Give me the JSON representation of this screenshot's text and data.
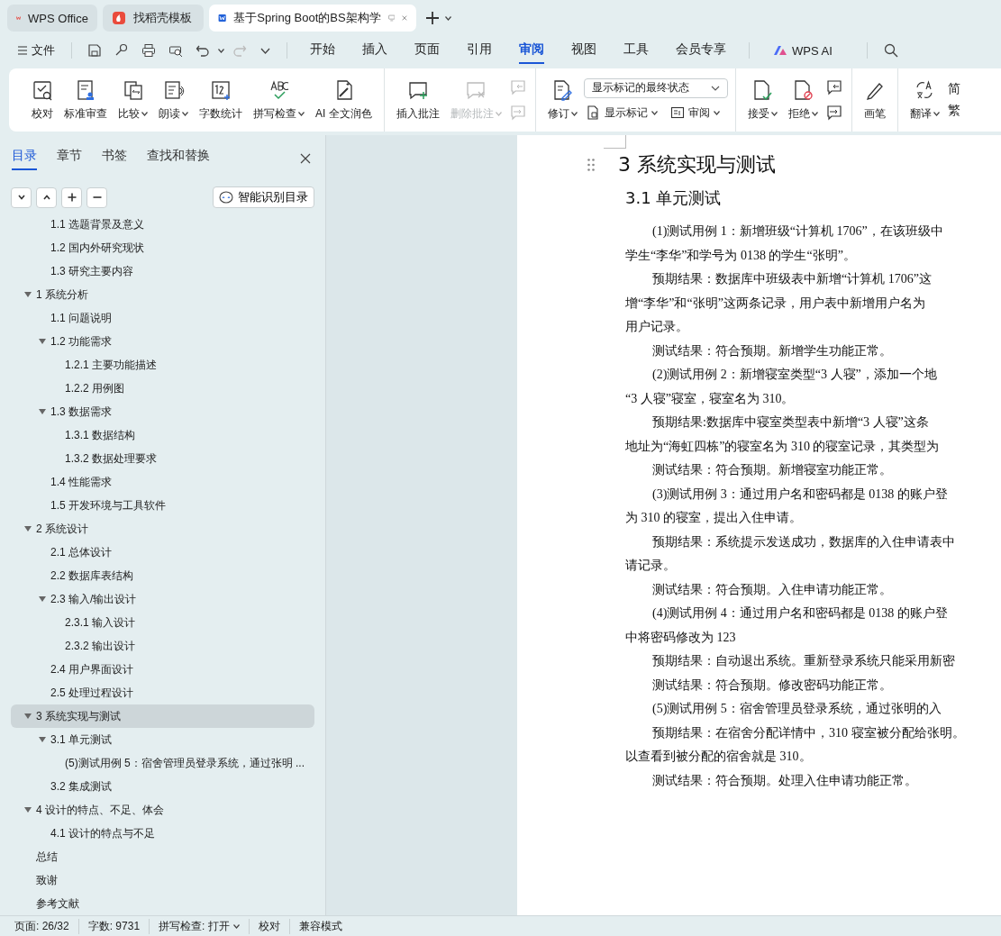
{
  "browser_tabs": [
    {
      "label": "WPS Office",
      "selected": false
    },
    {
      "label": "找稻壳模板",
      "selected": false
    },
    {
      "label": "基于Spring Boot的BS架构学",
      "selected": true
    }
  ],
  "menu": {
    "file_label": "文件",
    "tabs": [
      {
        "label": "开始",
        "selected": false
      },
      {
        "label": "插入",
        "selected": false
      },
      {
        "label": "页面",
        "selected": false
      },
      {
        "label": "引用",
        "selected": false
      },
      {
        "label": "审阅",
        "selected": true
      },
      {
        "label": "视图",
        "selected": false
      },
      {
        "label": "工具",
        "selected": false
      },
      {
        "label": "会员专享",
        "selected": false
      }
    ],
    "ai_label": "WPS AI"
  },
  "ribbon": {
    "groups": [
      {
        "items": [
          {
            "kind": "big",
            "label": "校对",
            "dropdown": false,
            "disabled": false
          },
          {
            "kind": "big",
            "label": "标准审查",
            "dropdown": false,
            "disabled": false
          },
          {
            "kind": "big",
            "label": "比较",
            "dropdown": true,
            "disabled": false
          },
          {
            "kind": "big",
            "label": "朗读",
            "dropdown": true,
            "disabled": false
          },
          {
            "kind": "big",
            "label": "字数统计",
            "dropdown": false,
            "disabled": false
          },
          {
            "kind": "big",
            "label": "拼写检查",
            "dropdown": true,
            "disabled": false
          },
          {
            "kind": "big",
            "label": "AI 全文润色",
            "dropdown": false,
            "disabled": false
          }
        ]
      },
      {
        "items": [
          {
            "kind": "big",
            "label": "插入批注",
            "dropdown": false,
            "disabled": false
          },
          {
            "kind": "big",
            "label": "删除批注",
            "dropdown": true,
            "disabled": true
          },
          {
            "kind": "stack",
            "rows": [
              [
                {
                  "kind": "icon",
                  "disabled": true
                }
              ],
              [
                {
                  "kind": "icon",
                  "disabled": true
                }
              ]
            ]
          }
        ]
      },
      {
        "items": [
          {
            "kind": "big",
            "label": "修订",
            "dropdown": true,
            "disabled": false
          },
          {
            "kind": "stack",
            "rows": [
              [
                {
                  "kind": "select",
                  "label": "显示标记的最终状态",
                  "disabled": false
                }
              ],
              [
                {
                  "kind": "small",
                  "label": "显示标记",
                  "dropdown": true,
                  "disabled": false
                },
                {
                  "kind": "small",
                  "label": "审阅",
                  "dropdown": true,
                  "disabled": false
                }
              ]
            ]
          }
        ]
      },
      {
        "items": [
          {
            "kind": "big",
            "label": "接受",
            "dropdown": true,
            "disabled": false
          },
          {
            "kind": "big",
            "label": "拒绝",
            "dropdown": true,
            "disabled": false
          },
          {
            "kind": "stack",
            "rows": [
              [
                {
                  "kind": "icon",
                  "disabled": false
                }
              ],
              [
                {
                  "kind": "icon",
                  "disabled": false
                }
              ]
            ]
          }
        ]
      },
      {
        "items": [
          {
            "kind": "big",
            "label": "画笔",
            "dropdown": false,
            "disabled": false
          }
        ]
      },
      {
        "items": [
          {
            "kind": "big",
            "label": "翻译",
            "dropdown": true,
            "disabled": false
          },
          {
            "kind": "stack",
            "rows": [
              [
                {
                  "kind": "glyph",
                  "label": "简",
                  "disabled": false
                }
              ],
              [
                {
                  "kind": "glyph",
                  "label": "繁",
                  "disabled": false
                }
              ]
            ]
          }
        ]
      }
    ]
  },
  "toc": {
    "tabs": [
      {
        "label": "目录",
        "selected": true
      },
      {
        "label": "章节",
        "selected": false
      },
      {
        "label": "书签",
        "selected": false
      },
      {
        "label": "查找和替换",
        "selected": false
      }
    ],
    "smart_button": "智能识别目录",
    "continued_items": [
      {
        "label": "1.1 选题背景及意义",
        "selected": false
      },
      {
        "label": "1.2 国内外研究现状",
        "selected": false
      },
      {
        "label": "1.3 研究主要内容",
        "selected": false
      }
    ],
    "items": [
      {
        "label": "1 系统分析",
        "selected": false,
        "expanded": true,
        "children": [
          {
            "label": "1.1 问题说明",
            "selected": false
          },
          {
            "label": "1.2 功能需求",
            "selected": false,
            "expanded": true,
            "children": [
              {
                "label": "1.2.1 主要功能描述",
                "selected": false
              },
              {
                "label": "1.2.2 用例图",
                "selected": false
              }
            ]
          },
          {
            "label": "1.3 数据需求",
            "selected": false,
            "expanded": true,
            "children": [
              {
                "label": "1.3.1 数据结构",
                "selected": false
              },
              {
                "label": "1.3.2 数据处理要求",
                "selected": false
              }
            ]
          },
          {
            "label": "1.4 性能需求",
            "selected": false
          },
          {
            "label": "1.5 开发环境与工具软件",
            "selected": false
          }
        ]
      },
      {
        "label": "2 系统设计",
        "selected": false,
        "expanded": true,
        "children": [
          {
            "label": "2.1 总体设计",
            "selected": false
          },
          {
            "label": "2.2 数据库表结构",
            "selected": false
          },
          {
            "label": "2.3 输入/输出设计",
            "selected": false,
            "expanded": true,
            "children": [
              {
                "label": "2.3.1 输入设计",
                "selected": false
              },
              {
                "label": "2.3.2 输出设计",
                "selected": false
              }
            ]
          },
          {
            "label": "2.4 用户界面设计",
            "selected": false
          },
          {
            "label": "2.5 处理过程设计",
            "selected": false
          }
        ]
      },
      {
        "label": "3 系统实现与测试",
        "selected": true,
        "expanded": true,
        "children": [
          {
            "label": "3.1 单元测试",
            "selected": false,
            "expanded": true,
            "children": [
              {
                "label": "(5)测试用例 5：宿舍管理员登录系统，通过张明 ...",
                "selected": false
              }
            ]
          },
          {
            "label": "3.2 集成测试",
            "selected": false
          }
        ]
      },
      {
        "label": "4 设计的特点、不足、体会",
        "selected": false,
        "expanded": true,
        "children": [
          {
            "label": "4.1 设计的特点与不足",
            "selected": false
          }
        ]
      },
      {
        "label": "总结",
        "selected": false
      },
      {
        "label": "致谢",
        "selected": false
      },
      {
        "label": "参考文献",
        "selected": false
      }
    ]
  },
  "document": {
    "heading": "3 系统实现与测试",
    "subheading": "3.1 单元测试",
    "lines": [
      {
        "text": "(1)测试用例 1：新增班级“计算机 1706”，在该班级中",
        "indent": true
      },
      {
        "text": "学生“李华”和学号为 0138 的学生“张明”。",
        "indent": false
      },
      {
        "text": "预期结果：数据库中班级表中新增“计算机 1706”这",
        "indent": true
      },
      {
        "text": "增“李华”和“张明”这两条记录，用户表中新增用户名为",
        "indent": false
      },
      {
        "text": "用户记录。",
        "indent": false
      },
      {
        "text": "测试结果：符合预期。新增学生功能正常。",
        "indent": true
      },
      {
        "text": "(2)测试用例 2：新增寝室类型“3 人寝”，添加一个地",
        "indent": true
      },
      {
        "text": "“3 人寝”寝室，寝室名为 310。",
        "indent": false
      },
      {
        "text": "预期结果:数据库中寝室类型表中新增“3 人寝”这条",
        "indent": true
      },
      {
        "text": "地址为“海虹四栋”的寝室名为 310 的寝室记录，其类型为",
        "indent": false
      },
      {
        "text": "测试结果：符合预期。新增寝室功能正常。",
        "indent": true
      },
      {
        "text": "(3)测试用例 3：通过用户名和密码都是 0138 的账户登",
        "indent": true
      },
      {
        "text": "为 310 的寝室，提出入住申请。",
        "indent": false
      },
      {
        "text": "预期结果：系统提示发送成功，数据库的入住申请表中",
        "indent": true
      },
      {
        "text": "请记录。",
        "indent": false
      },
      {
        "text": "测试结果：符合预期。入住申请功能正常。",
        "indent": true
      },
      {
        "text": "(4)测试用例 4：通过用户名和密码都是 0138 的账户登",
        "indent": true
      },
      {
        "text": "中将密码修改为 123",
        "indent": false
      },
      {
        "text": "预期结果：自动退出系统。重新登录系统只能采用新密",
        "indent": true
      },
      {
        "text": "测试结果：符合预期。修改密码功能正常。",
        "indent": true
      },
      {
        "text": "(5)测试用例 5：宿舍管理员登录系统，通过张明的入",
        "indent": true
      },
      {
        "text": "预期结果：在宿舍分配详情中，310 寝室被分配给张明。",
        "indent": true
      },
      {
        "text": "以查看到被分配的宿舍就是 310。",
        "indent": false
      },
      {
        "text": "测试结果：符合预期。处理入住申请功能正常。",
        "indent": true
      }
    ]
  },
  "status_bar": [
    {
      "label": "页面: 26/32",
      "dropdown": false
    },
    {
      "label": "字数: 9731",
      "dropdown": false
    },
    {
      "label": "拼写检查: 打开",
      "dropdown": true
    },
    {
      "label": "校对",
      "dropdown": false
    },
    {
      "label": "兼容模式",
      "dropdown": false
    }
  ]
}
